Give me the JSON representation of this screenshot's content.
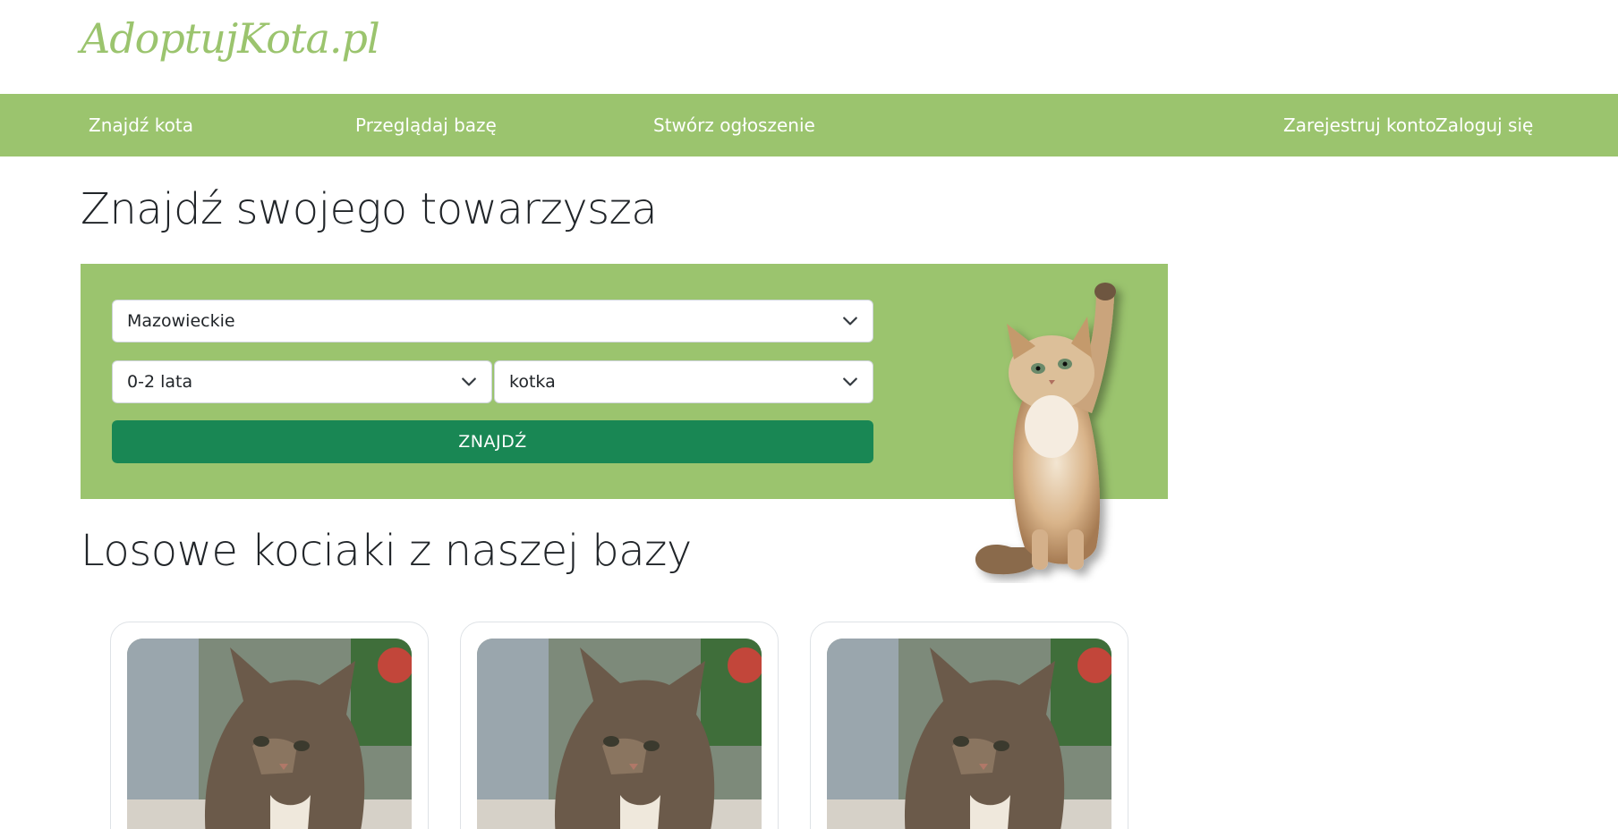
{
  "header": {
    "logo": "AdoptujKota.pl"
  },
  "nav": {
    "find_cat": "Znajdź kota",
    "browse": "Przeglądaj bazę",
    "create": "Stwórz ogłoszenie",
    "register": "Zarejestruj konto",
    "login": "Zaloguj się"
  },
  "main": {
    "heading": "Znajdź swojego towarzysza",
    "search": {
      "region": "Mazowieckie",
      "age": "0-2 lata",
      "sex": "kotka",
      "button": "ZNAJDŹ"
    },
    "random_heading": "Losowe kociaki z naszej bazy"
  },
  "colors": {
    "accent_green": "#9bc46e",
    "button_green": "#198754"
  },
  "icons": {
    "select_arrow": "chevron-down-icon"
  }
}
